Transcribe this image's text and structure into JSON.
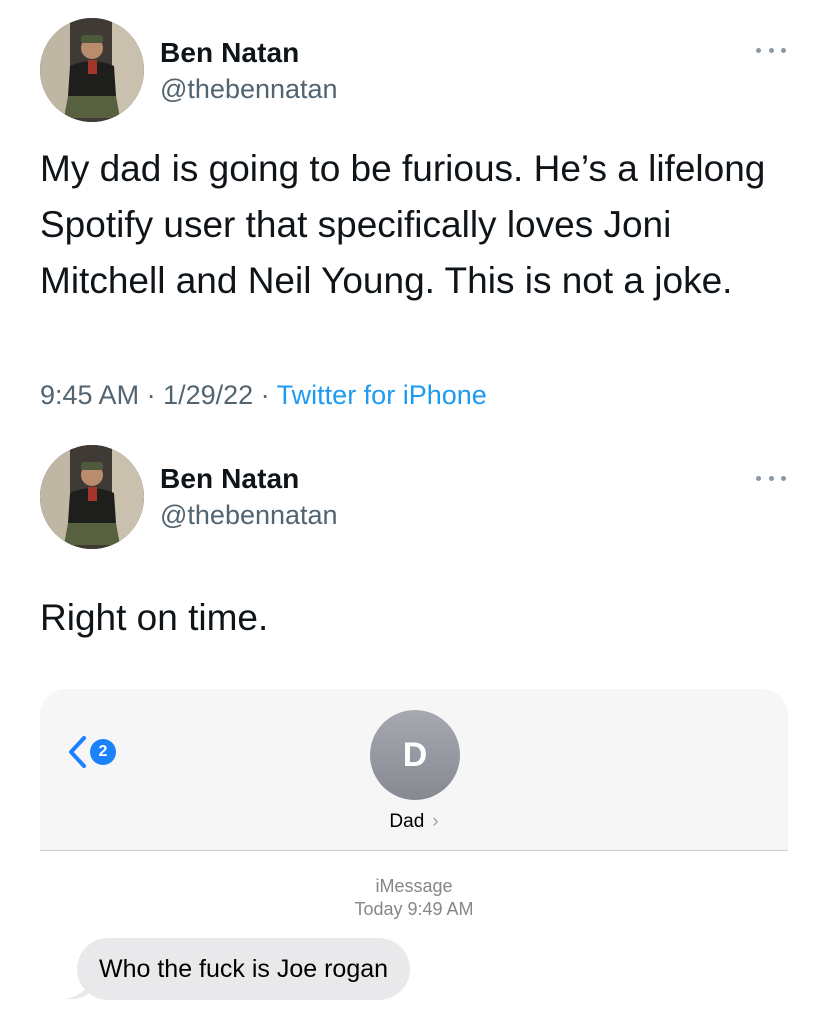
{
  "tweets": [
    {
      "author": {
        "name": "Ben Natan",
        "handle": "@thebennatan"
      },
      "text": "My dad is going to be furious. He’s a lifelong Spotify user that specifically loves Joni Mitchell and Neil Young. This is not a joke.",
      "time": "9:45 AM",
      "date": "1/29/22",
      "separator": " · ",
      "source": "Twitter for iPhone"
    },
    {
      "author": {
        "name": "Ben Natan",
        "handle": "@thebennatan"
      },
      "text": "Right on time."
    }
  ],
  "imessage": {
    "back_badge": "2",
    "contact_initial": "D",
    "contact_name": "Dad",
    "chevron": "›",
    "service": "iMessage",
    "timestamp": "Today 9:49 AM",
    "messages": [
      {
        "from": "them",
        "text": "Who the fuck is Joe rogan"
      }
    ]
  },
  "icons": [
    "more-icon",
    "back-chevron-icon",
    "chevron-right-icon"
  ],
  "colors": {
    "link": "#1d9bf0",
    "badge": "#1a82fb",
    "bubble": "#e9e9eb",
    "secondary_text": "#536471"
  }
}
